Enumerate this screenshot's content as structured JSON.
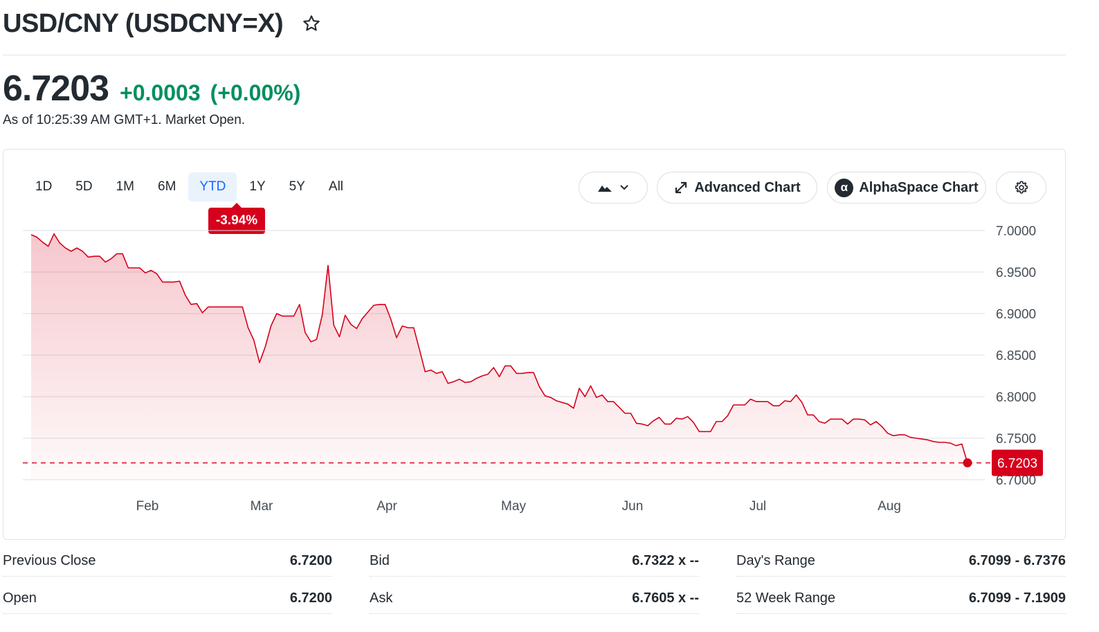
{
  "header": {
    "title": "USD/CNY (USDCNY=X)",
    "price": "6.7203",
    "change": "+0.0003",
    "change_pct": "(+0.00%)",
    "as_of": "As of 10:25:39 AM GMT+1. Market Open.",
    "positive_color": "#008f5d"
  },
  "chart_controls": {
    "ranges": [
      "1D",
      "5D",
      "1M",
      "6M",
      "YTD",
      "1Y",
      "5Y",
      "All"
    ],
    "active_range": "YTD",
    "range_change": "-3.94%",
    "chart_type_icon": "mountain-chart-icon",
    "advanced_chart_label": "Advanced Chart",
    "alphaspace_label": "AlphaSpace Chart",
    "settings_icon": "gear-icon"
  },
  "chart_data": {
    "type": "area",
    "title": "",
    "xlabel": "",
    "ylabel": "",
    "x_tick_labels": [
      "Feb",
      "Mar",
      "Apr",
      "May",
      "Jun",
      "Jul",
      "Aug"
    ],
    "y_tick_labels": [
      "7.0000",
      "6.9500",
      "6.9000",
      "6.8500",
      "6.8000",
      "6.7500",
      "6.7000"
    ],
    "ylim": [
      6.7,
      7.0
    ],
    "grid": true,
    "current_value": 6.7203,
    "current_label": "6.7203",
    "line_color": "#d6001c",
    "series": [
      {
        "values": [
          6.995,
          6.992,
          6.986,
          6.981,
          6.996,
          6.985,
          6.979,
          6.975,
          6.979,
          6.975,
          6.968,
          6.969,
          6.969,
          6.962,
          6.966,
          6.972,
          6.972,
          6.955,
          6.955,
          6.955,
          6.949,
          6.952,
          6.948,
          6.938,
          6.938,
          6.938,
          6.939,
          6.922,
          6.911,
          6.912,
          6.901,
          6.908,
          6.908,
          6.908,
          6.908,
          6.908,
          6.908,
          6.908,
          6.883,
          6.868,
          6.841,
          6.86,
          6.885,
          6.9,
          6.897,
          6.897,
          6.897,
          6.911,
          6.877,
          6.866,
          6.869,
          6.899,
          6.958,
          6.886,
          6.872,
          6.898,
          6.887,
          6.882,
          6.894,
          6.902,
          6.91,
          6.911,
          6.911,
          6.893,
          6.871,
          6.885,
          6.883,
          6.883,
          6.857,
          6.83,
          6.832,
          6.828,
          6.83,
          6.816,
          6.818,
          6.821,
          6.817,
          6.818,
          6.822,
          6.825,
          6.827,
          6.835,
          6.824,
          6.837,
          6.837,
          6.828,
          6.828,
          6.829,
          6.829,
          6.812,
          6.801,
          6.799,
          6.795,
          6.793,
          6.791,
          6.786,
          6.81,
          6.8,
          6.813,
          6.799,
          6.802,
          6.794,
          6.794,
          6.787,
          6.78,
          6.78,
          6.768,
          6.767,
          6.765,
          6.771,
          6.775,
          6.767,
          6.767,
          6.774,
          6.773,
          6.776,
          6.769,
          6.758,
          6.758,
          6.758,
          6.77,
          6.77,
          6.777,
          6.79,
          6.79,
          6.79,
          6.797,
          6.794,
          6.794,
          6.794,
          6.789,
          6.789,
          6.795,
          6.794,
          6.802,
          6.793,
          6.778,
          6.778,
          6.77,
          6.768,
          6.773,
          6.773,
          6.773,
          6.767,
          6.773,
          6.773,
          6.772,
          6.766,
          6.77,
          6.764,
          6.756,
          6.753,
          6.754,
          6.754,
          6.751,
          6.75,
          6.749,
          6.748,
          6.746,
          6.745,
          6.745,
          6.744,
          6.741,
          6.743,
          6.72
        ]
      }
    ]
  },
  "stats": [
    {
      "label": "Previous Close",
      "value": "6.7200"
    },
    {
      "label": "Open",
      "value": "6.7200"
    },
    {
      "label": "Bid",
      "value": "6.7322 x --"
    },
    {
      "label": "Ask",
      "value": "6.7605 x --"
    },
    {
      "label": "Day's Range",
      "value": "6.7099 - 6.7376"
    },
    {
      "label": "52 Week Range",
      "value": "6.7099 - 7.1909"
    }
  ]
}
